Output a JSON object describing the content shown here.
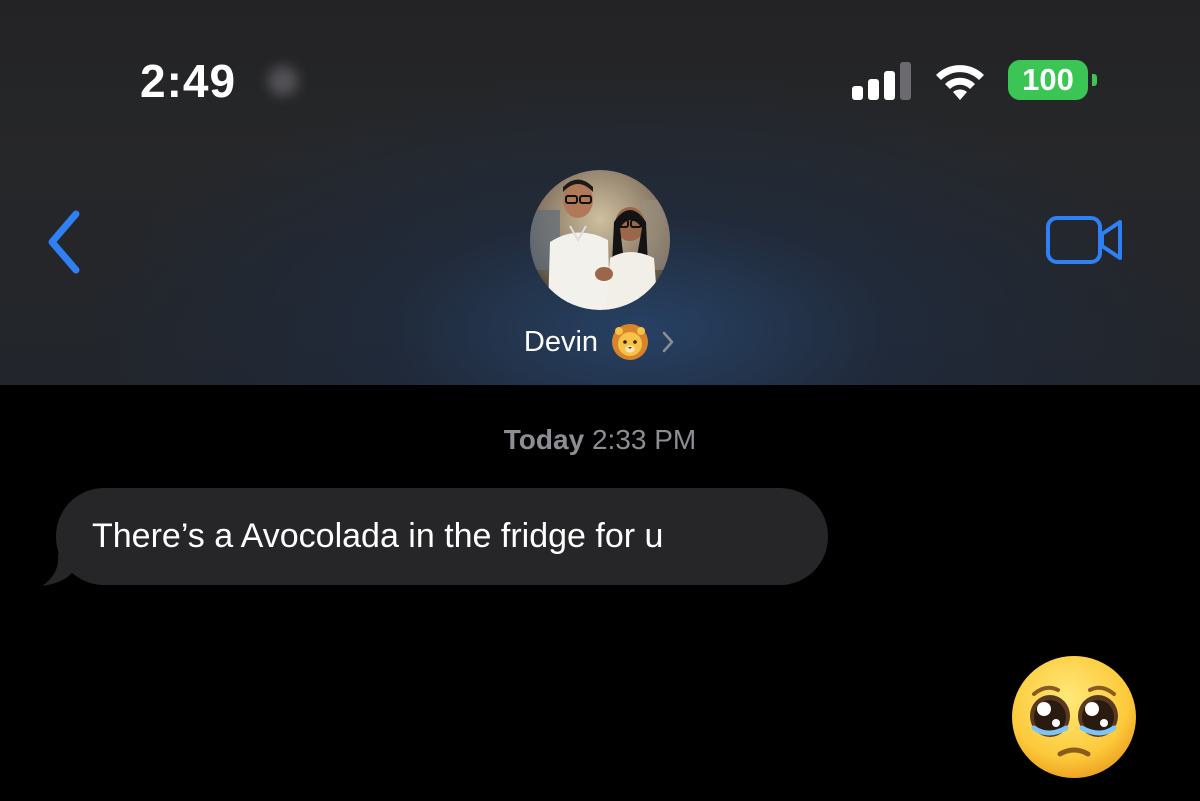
{
  "status_bar": {
    "time": "2:49",
    "battery_level": "100"
  },
  "nav": {
    "back_icon": "chevron-left-icon",
    "video_call_icon": "video-camera-icon",
    "accent_color": "#2f7ff5"
  },
  "contact": {
    "name": "Devin",
    "name_emoji_icon": "lion-face-icon",
    "disclosure_icon": "chevron-right-icon"
  },
  "conversation": {
    "timestamp_day": "Today",
    "timestamp_time": "2:33 PM",
    "messages": [
      {
        "direction": "incoming",
        "text": "There’s a Avocolada in the fridge for u"
      }
    ],
    "reply_emoji_icon": "pleading-face-icon"
  },
  "colors": {
    "bubble_incoming": "#262628",
    "battery_green": "#3ac554",
    "timestamp_gray": "#8d8d93"
  }
}
